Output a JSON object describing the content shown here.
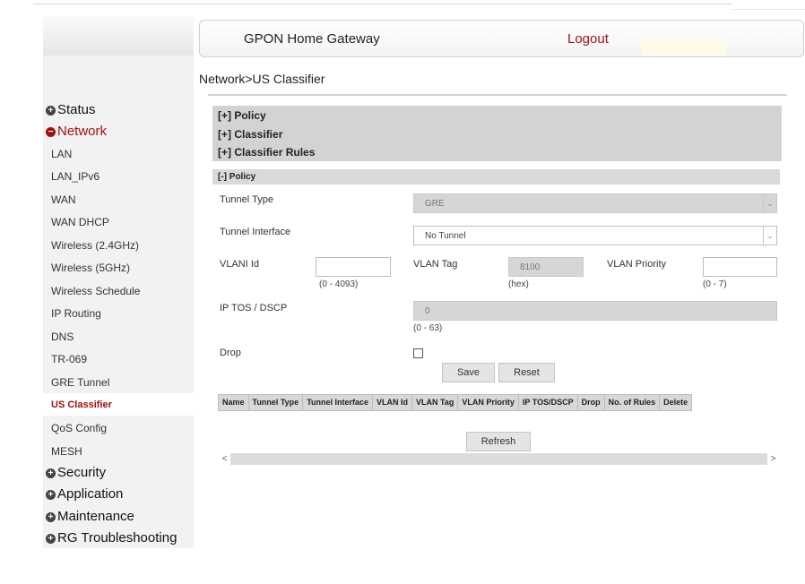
{
  "header": {
    "title": "GPON Home Gateway",
    "logout": "Logout"
  },
  "breadcrumb": "Network>US Classifier",
  "sidebar": {
    "sections_top": [
      {
        "label": "Status",
        "icon": "plus-circle-icon"
      },
      {
        "label": "Network",
        "icon": "minus-circle-icon"
      }
    ],
    "items": [
      "LAN",
      "LAN_IPv6",
      "WAN",
      "WAN DHCP",
      "Wireless (2.4GHz)",
      "Wireless (5GHz)",
      "Wireless Schedule",
      "IP Routing",
      "DNS",
      "TR-069",
      "GRE Tunnel",
      "US Classifier",
      "QoS Config",
      "MESH"
    ],
    "active_item": "US Classifier",
    "sections_bottom": [
      {
        "label": "Security",
        "icon": "plus-circle-icon"
      },
      {
        "label": "Application",
        "icon": "plus-circle-icon"
      },
      {
        "label": "Maintenance",
        "icon": "plus-circle-icon"
      },
      {
        "label": "RG Troubleshooting",
        "icon": "plus-circle-icon"
      }
    ]
  },
  "collapsed_sections": [
    "[+] Policy",
    "[+] Classifier",
    "[+] Classifier Rules"
  ],
  "policy": {
    "heading": "[-] Policy",
    "tunnel_type_label": "Tunnel Type",
    "tunnel_type_value": "GRE",
    "tunnel_interface_label": "Tunnel Interface",
    "tunnel_interface_value": "No Tunnel",
    "vlan_id_label": "VLANI Id",
    "vlan_id_value": "",
    "vlan_id_hint": "(0 - 4093)",
    "vlan_tag_label": "VLAN Tag",
    "vlan_tag_value": "8100",
    "vlan_tag_hint": "(hex)",
    "vlan_priority_label": "VLAN Priority",
    "vlan_priority_value": "",
    "vlan_priority_hint": "(0 - 7)",
    "ip_tos_label": "IP TOS / DSCP",
    "ip_tos_value": "0",
    "ip_tos_hint": "(0 - 63)",
    "drop_label": "Drop",
    "save_label": "Save",
    "reset_label": "Reset"
  },
  "table": {
    "columns": [
      "Name",
      "Tunnel Type",
      "Tunnel Interface",
      "VLAN Id",
      "VLAN Tag",
      "VLAN Priority",
      "IP TOS/DSCP",
      "Drop",
      "No. of Rules",
      "Delete"
    ]
  },
  "refresh_label": "Refresh",
  "scroll": {
    "left_icon": "<",
    "right_icon": ">"
  },
  "colors": {
    "accent": "#a30f0f",
    "panel": "#d3d3d3",
    "sidebar_bg": "#f2f2f2"
  }
}
